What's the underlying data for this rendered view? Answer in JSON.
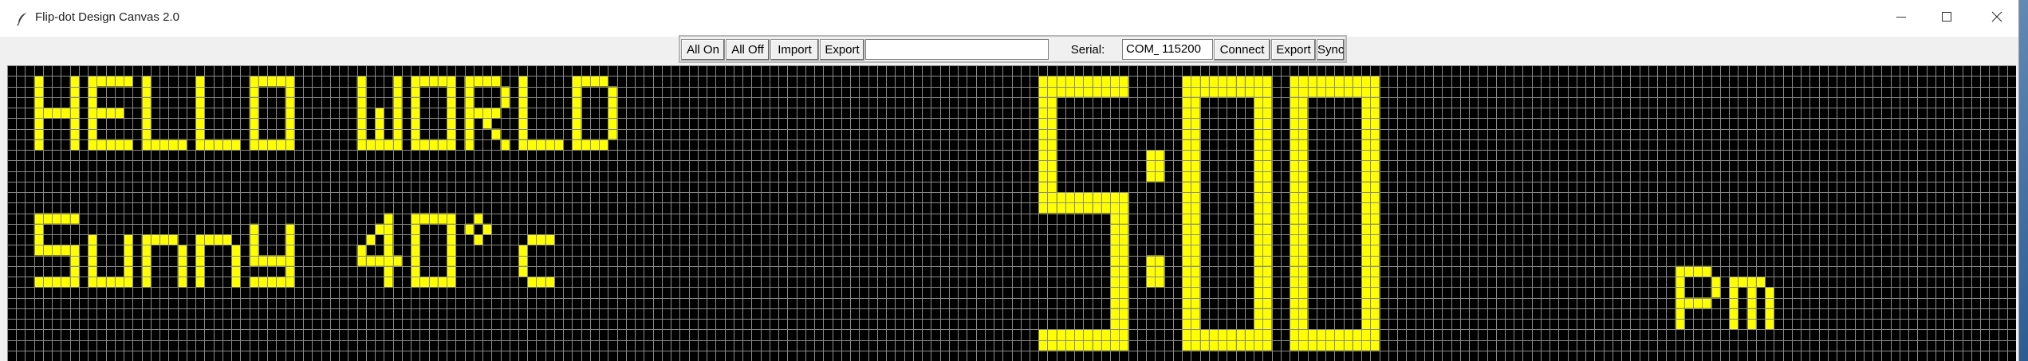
{
  "window": {
    "title": "Flip-dot Design Canvas 2.0",
    "icons": {
      "app": "feather-icon",
      "minimize": "minimize-icon",
      "maximize": "maximize-icon",
      "close": "close-icon"
    }
  },
  "toolbar": {
    "all_on_label": "All On",
    "all_off_label": "All Off",
    "import_label": "Import",
    "export_label": "Export",
    "text_entry_value": "",
    "serial_label": "Serial:",
    "port_value": "COM_",
    "baud_value": "115200",
    "connect_label": "Connect",
    "export2_label": "Export",
    "sync_label": "Sync"
  },
  "display": {
    "columns": 224,
    "rows": 28,
    "dot_on_color": "#ffff00",
    "dot_off_color": "#000000",
    "grid_color": "#8a8a8a",
    "texts": [
      {
        "text": "HELLO WORLD",
        "font": "5x7",
        "col": 3,
        "row": 1
      },
      {
        "text": "Sunny 40°c",
        "font": "5x7",
        "col": 3,
        "row": 14
      },
      {
        "text": "5:00",
        "font": "large",
        "col": 115,
        "row": 1
      },
      {
        "text": "pm",
        "font": "5x7",
        "col": 186,
        "row": 18
      }
    ]
  }
}
